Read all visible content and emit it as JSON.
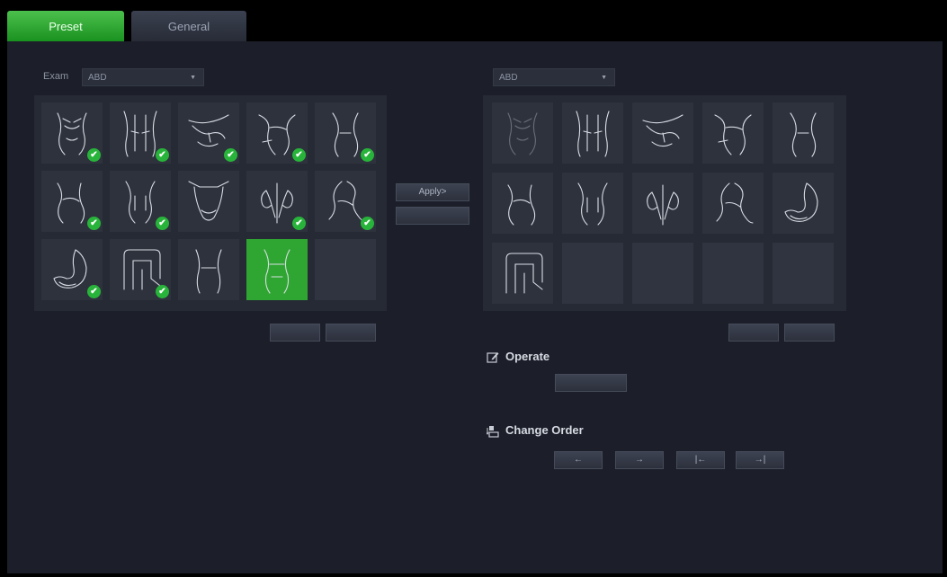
{
  "tabs": [
    {
      "label": "Preset"
    },
    {
      "label": "General"
    }
  ],
  "exam": {
    "label": "Exam",
    "value": "ABD"
  },
  "right": {
    "value": "ABD"
  },
  "buttons": {
    "apply": "Apply>",
    "remove": ""
  },
  "operate": {
    "title": "Operate",
    "icon": "edit-icon"
  },
  "change_order": {
    "title": "Change Order",
    "icon": "order-icon",
    "left": "←",
    "right": "→",
    "first": "|←",
    "last": "→|"
  },
  "left_presets": [
    {
      "icon": "abdomen-front-icon",
      "checked": true
    },
    {
      "icon": "abdomen-torso-icon",
      "checked": true
    },
    {
      "icon": "liver-gallbladder-icon",
      "checked": true
    },
    {
      "icon": "abdomen-oblique-icon",
      "checked": true
    },
    {
      "icon": "abdomen-side-icon",
      "checked": true
    },
    {
      "icon": "abdomen-left-icon",
      "checked": true
    },
    {
      "icon": "abdomen-lower-icon",
      "checked": true
    },
    {
      "icon": "pelvis-icon",
      "checked": false
    },
    {
      "icon": "kidneys-icon",
      "checked": true
    },
    {
      "icon": "aorta-icon",
      "checked": true
    },
    {
      "icon": "stomach-icon",
      "checked": true
    },
    {
      "icon": "bowel-icon",
      "checked": true
    },
    {
      "icon": "abdomen-back-icon",
      "checked": false
    },
    {
      "icon": "abdomen-selected-icon",
      "checked": false,
      "selected": true
    }
  ],
  "right_presets": [
    {
      "icon": "abdomen-front-icon"
    },
    {
      "icon": "abdomen-torso-icon"
    },
    {
      "icon": "liver-gallbladder-icon"
    },
    {
      "icon": "abdomen-oblique-icon"
    },
    {
      "icon": "abdomen-side-icon"
    },
    {
      "icon": "abdomen-left-icon"
    },
    {
      "icon": "abdomen-lower-icon"
    },
    {
      "icon": "kidneys-icon"
    },
    {
      "icon": "aorta-icon"
    },
    {
      "icon": "stomach-icon"
    },
    {
      "icon": "bowel-icon"
    }
  ]
}
